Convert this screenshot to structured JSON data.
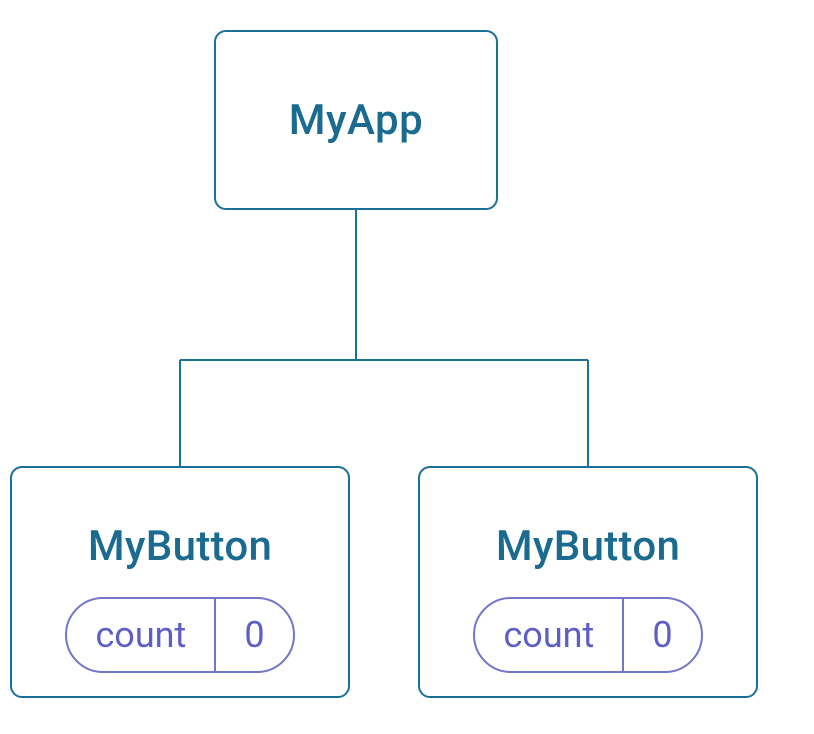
{
  "root": {
    "label": "MyApp"
  },
  "children": [
    {
      "label": "MyButton",
      "state": {
        "count_label": "count",
        "count_value": "0"
      }
    },
    {
      "label": "MyButton",
      "state": {
        "count_label": "count",
        "count_value": "0"
      }
    }
  ]
}
